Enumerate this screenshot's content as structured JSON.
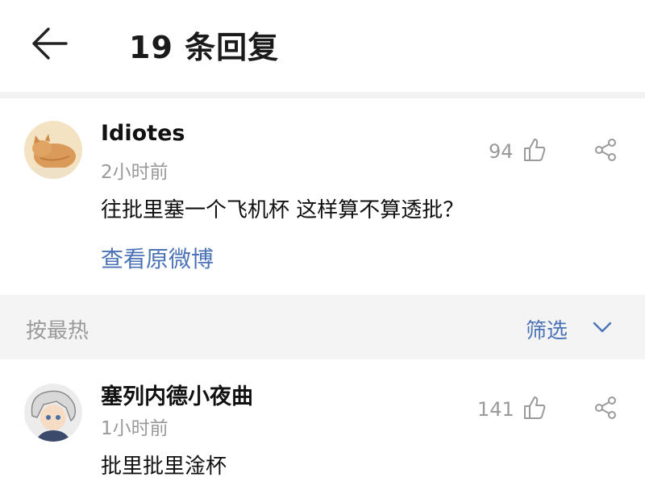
{
  "header": {
    "title": "19 条回复",
    "back_icon": "arrow-left-icon"
  },
  "post": {
    "username": "Idiotes",
    "time": "2小时前",
    "like_count": "94",
    "content": "往批里塞一个飞机杯 这样算不算透批？",
    "link_text": "查看原微博",
    "link_color": "#4b73b6"
  },
  "sort_bar": {
    "sort_label": "按最热",
    "filter_label": "筛选",
    "filter_icon": "chevron-down-icon"
  },
  "reply": {
    "username": "塞列内德小夜曲",
    "time": "1小时前",
    "like_count": "141",
    "content": "批里批里淦杯"
  },
  "icons": {
    "like": "thumb-up-icon",
    "share": "share-icon"
  }
}
